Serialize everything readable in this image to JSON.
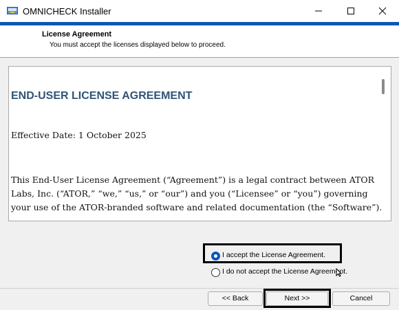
{
  "window": {
    "title": "OMNICHECK Installer",
    "accent_color": "#0b57b5"
  },
  "header": {
    "title": "License Agreement",
    "subtitle": "You must accept the licenses displayed below to proceed."
  },
  "license": {
    "heading": "END-USER LICENSE AGREEMENT",
    "effective_date": "Effective Date: 1 October 2025",
    "paragraph": "This End-User License Agreement (“Agreement”) is a legal contract between ATOR Labs, Inc. (“ATOR,” “we,” “us,” or “our”) and you (“Licensee” or “you”) governing your use of the ATOR-branded software and related documentation (the “Software”).",
    "heading_color": "#2f5478"
  },
  "options": {
    "accept_label": "I accept the License Agreement.",
    "decline_label": "I do not accept the License Agreement.",
    "selected": "accept"
  },
  "buttons": {
    "back": "<< Back",
    "next": "Next >>",
    "cancel": "Cancel"
  },
  "icons": {
    "app": "installer-app-icon",
    "minimize": "minimize-icon",
    "maximize": "maximize-icon",
    "close": "close-icon",
    "cursor": "mouse-pointer-icon"
  }
}
